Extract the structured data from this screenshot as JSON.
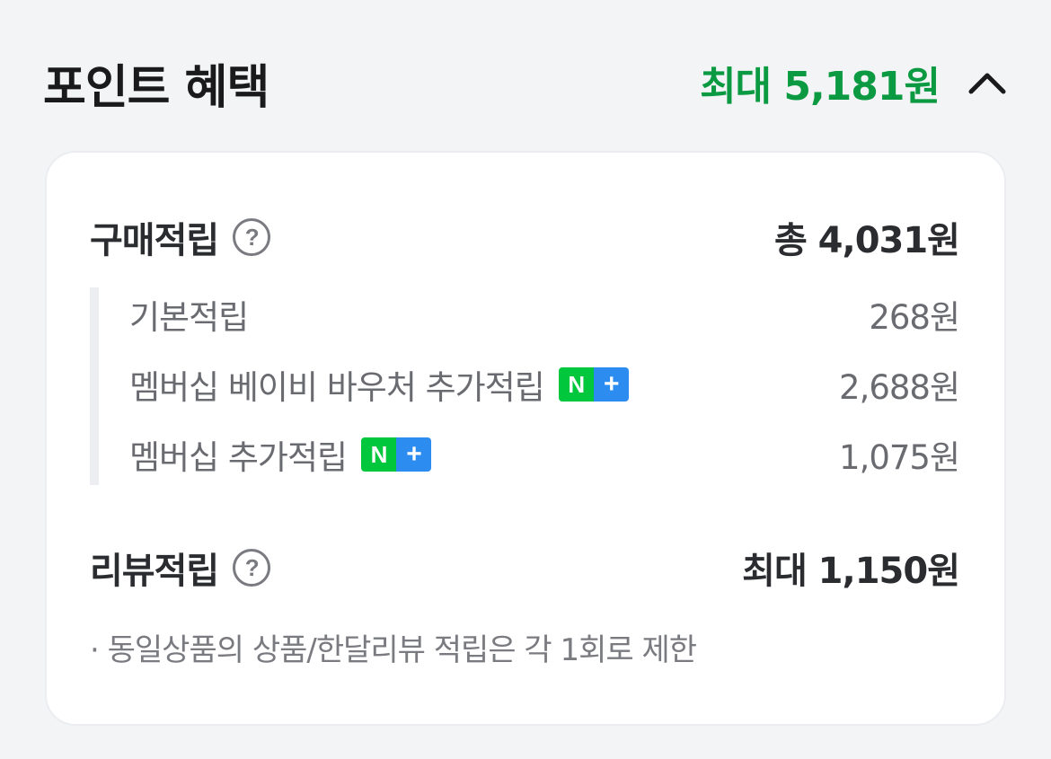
{
  "header": {
    "title": "포인트 혜택",
    "max_amount": "최대 5,181원",
    "toggle_icon": "chevron-up-icon"
  },
  "purchase": {
    "label": "구매적립",
    "help_icon": "question-circle-icon",
    "help_glyph": "?",
    "total": "총 4,031원",
    "items": [
      {
        "label": "기본적립",
        "value": "268원",
        "badge": false
      },
      {
        "label": "멤버십 베이비 바우처 추가적립",
        "value": "2,688원",
        "badge": true
      },
      {
        "label": "멤버십 추가적립",
        "value": "1,075원",
        "badge": true
      }
    ]
  },
  "badge": {
    "n": "N",
    "plus": "+"
  },
  "review": {
    "label": "리뷰적립",
    "help_icon": "question-circle-icon",
    "help_glyph": "?",
    "total": "최대 1,150원",
    "note": "· 동일상품의 상품/한달리뷰 적립은 각 1회로 제한"
  },
  "colors": {
    "accent_green": "#0b9a42",
    "badge_green": "#00c73c",
    "badge_blue": "#2d8cf0"
  }
}
